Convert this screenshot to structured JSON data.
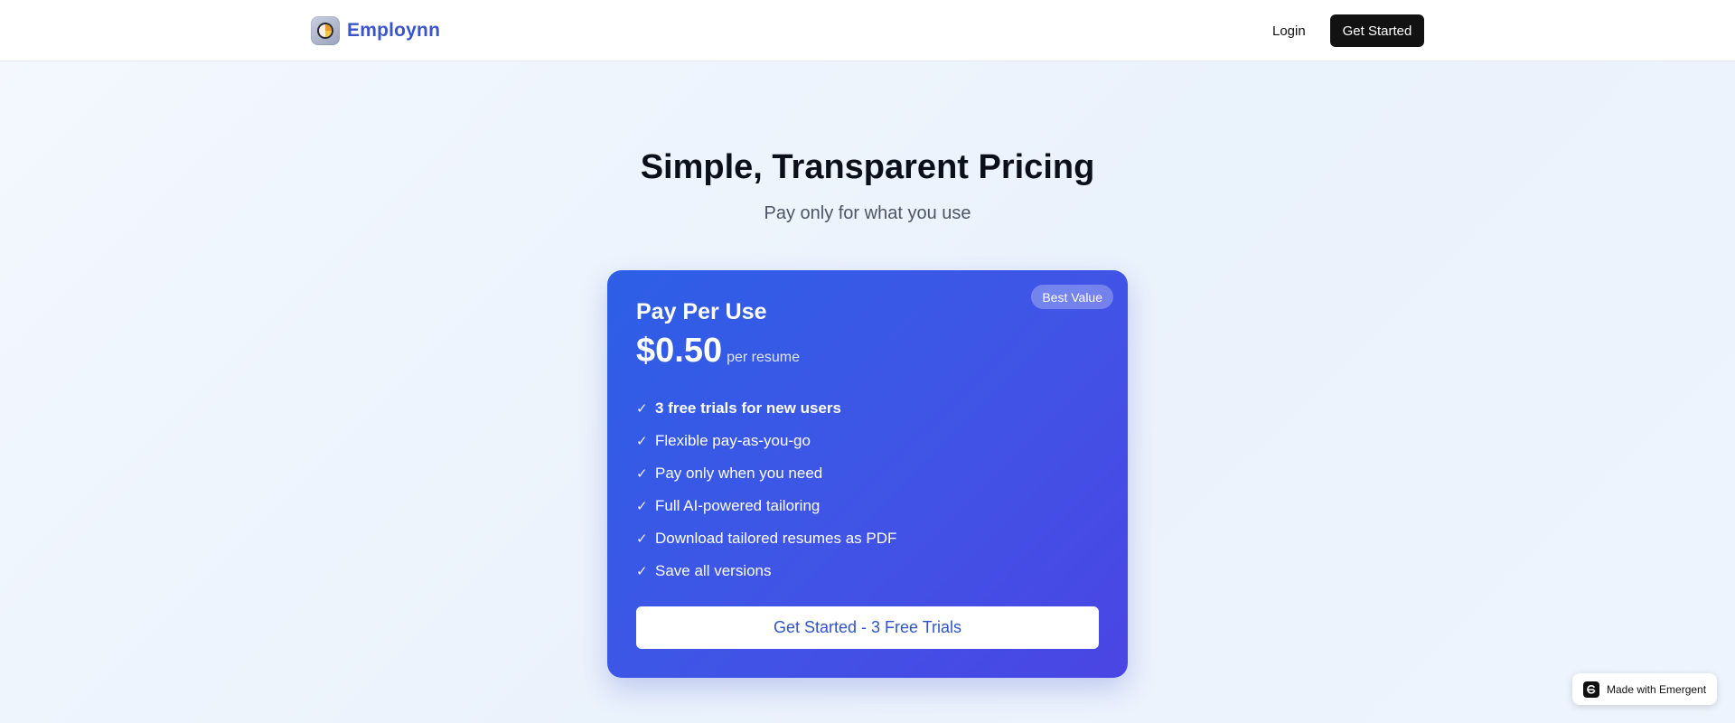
{
  "header": {
    "brand": "Employnn",
    "login_label": "Login",
    "cta_label": "Get Started"
  },
  "hero": {
    "title": "Simple, Transparent Pricing",
    "subtitle": "Pay only for what you use"
  },
  "plan": {
    "badge": "Best Value",
    "name": "Pay Per Use",
    "price": "$0.50",
    "price_unit": "per resume",
    "features": [
      "3 free trials for new users",
      "Flexible pay-as-you-go",
      "Pay only when you need",
      "Full AI-powered tailoring",
      "Download tailored resumes as PDF",
      "Save all versions"
    ],
    "check_glyph": "✓",
    "cta_label": "Get Started - 3 Free Trials"
  },
  "footer_badge": {
    "label": "Made with Emergent"
  },
  "colors": {
    "brand": "#3b55c6",
    "card_gradient_start": "#2d5fe6",
    "card_gradient_end": "#4a45e4",
    "dark_button": "#121212"
  },
  "icons": {
    "brand_logo": "chart-pie-icon",
    "feature_check": "check-icon",
    "made_with_logo": "emergent-logo-icon"
  }
}
